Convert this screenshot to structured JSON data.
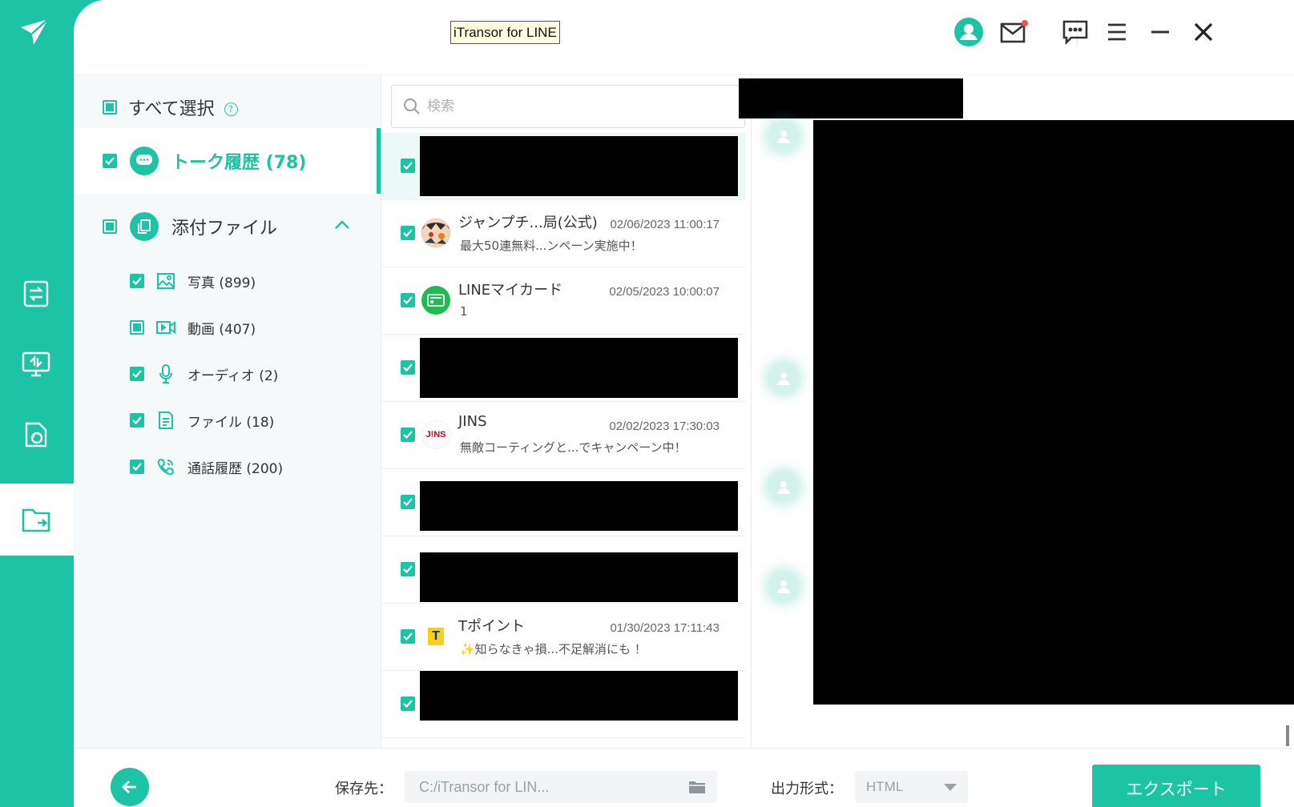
{
  "window": {
    "title_tooltip": "iTransor for LINE"
  },
  "colors": {
    "accent": "#1cc3a4",
    "panel_bg": "#f6f9fa",
    "selected_row": "#edf9f6"
  },
  "rail": {
    "items": [
      {
        "icon": "device-transfer-icon",
        "active": false
      },
      {
        "icon": "backup-computer-icon",
        "active": false
      },
      {
        "icon": "restore-icon",
        "active": false
      },
      {
        "icon": "export-folder-icon",
        "active": true
      }
    ]
  },
  "titlebar": {
    "icons": [
      "account-icon",
      "mail-icon",
      "feedback-icon",
      "menu-icon",
      "minimize-icon",
      "close-icon"
    ]
  },
  "categories": {
    "select_all_label": "すべて選択",
    "chats": {
      "label": "トーク履歴 (78)",
      "checked": true
    },
    "attachments": {
      "label": "添付ファイル",
      "state": "partial",
      "items": [
        {
          "label": "写真 (899)",
          "icon": "photo-icon",
          "checked": true
        },
        {
          "label": "動画 (407)",
          "icon": "video-icon",
          "checked": false
        },
        {
          "label": "オーディオ (2)",
          "icon": "microphone-icon",
          "checked": true
        },
        {
          "label": "ファイル (18)",
          "icon": "file-icon",
          "checked": true
        },
        {
          "label": "通話履歴 (200)",
          "icon": "phone-icon",
          "checked": true
        }
      ]
    }
  },
  "search": {
    "placeholder": "検索"
  },
  "messages": [
    {
      "redacted": true,
      "selected": true
    },
    {
      "name": "ジャンプチ...局(公式)",
      "time": "02/06/2023 11:00:17",
      "preview": "最大50連無料...ンペーン実施中！",
      "avatar": "anime-avatar"
    },
    {
      "name": "LINEマイカード",
      "time": "02/05/2023 10:00:07",
      "preview": "1",
      "avatar": "card-avatar"
    },
    {
      "redacted": true
    },
    {
      "name": "JINS",
      "time": "02/02/2023 17:30:03",
      "preview": "無敵コーティングと...でキャンペーン中！",
      "avatar": "jins-logo",
      "avatar_text": "J!NS"
    },
    {
      "redacted": true
    },
    {
      "redacted": true
    },
    {
      "name": "Tポイント",
      "time": "01/30/2023 17:11:43",
      "preview": "✨知らなきゃ損...不足解消にも ！",
      "avatar": "tpoint-logo",
      "avatar_text": "T"
    },
    {
      "redacted": true
    }
  ],
  "bottom": {
    "save_label": "保存先：",
    "save_path": "C:/iTransor for LIN...",
    "format_label": "出力形式：",
    "format_value": "HTML",
    "export_label": "エクスポート"
  }
}
